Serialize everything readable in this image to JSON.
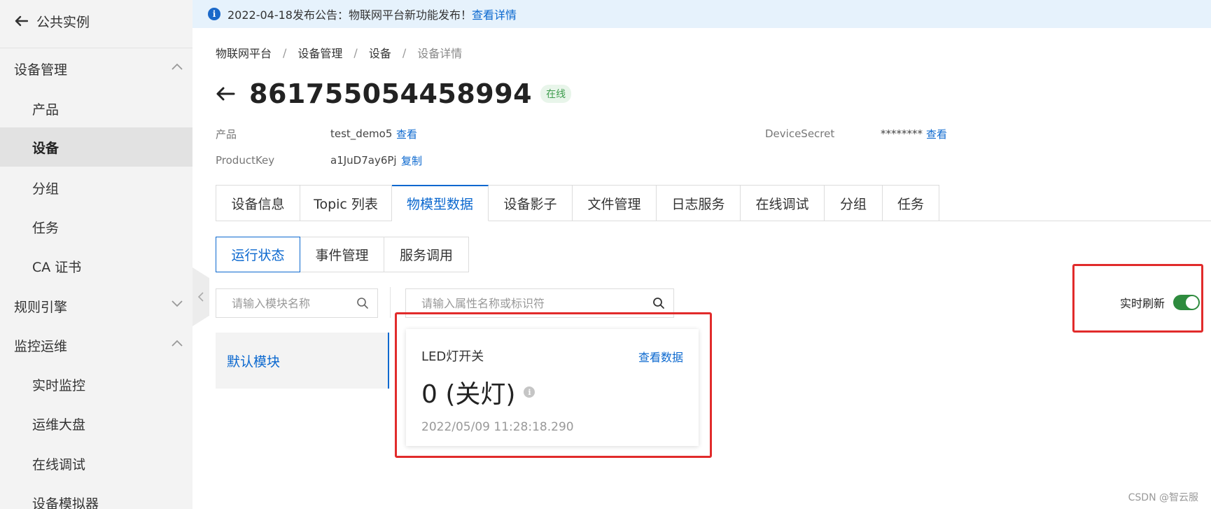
{
  "sidebar": {
    "back_label": "公共实例",
    "groups": [
      {
        "label": "设备管理",
        "expanded": true
      },
      {
        "label": "规则引擎",
        "expanded": false
      },
      {
        "label": "监控运维",
        "expanded": true
      }
    ],
    "device_items": [
      "产品",
      "设备",
      "分组",
      "任务",
      "CA 证书"
    ],
    "monitor_items": [
      "实时监控",
      "运维大盘",
      "在线调试",
      "设备模拟器"
    ],
    "active_item": "设备"
  },
  "notice": {
    "text": "2022-04-18发布公告：物联网平台新功能发布！",
    "link": "查看详情"
  },
  "breadcrumb": [
    "物联网平台",
    "设备管理",
    "设备",
    "设备详情"
  ],
  "device": {
    "name": "861755054458994",
    "status": "在线",
    "product_label": "产品",
    "product_value": "test_demo5",
    "product_action": "查看",
    "productkey_label": "ProductKey",
    "productkey_value": "a1JuD7ay6Pj",
    "productkey_action": "复制",
    "secret_label": "DeviceSecret",
    "secret_value": "********",
    "secret_action": "查看"
  },
  "tabs": [
    "设备信息",
    "Topic 列表",
    "物模型数据",
    "设备影子",
    "文件管理",
    "日志服务",
    "在线调试",
    "分组",
    "任务"
  ],
  "active_tab": "物模型数据",
  "subtabs": [
    "运行状态",
    "事件管理",
    "服务调用"
  ],
  "active_subtab": "运行状态",
  "search": {
    "module_placeholder": "请输入模块名称",
    "property_placeholder": "请输入属性名称或标识符"
  },
  "module": {
    "label": "默认模块"
  },
  "property_card": {
    "name": "LED灯开关",
    "link": "查看数据",
    "value": "0 (关灯)",
    "time": "2022/05/09 11:28:18.290"
  },
  "realtime": {
    "label": "实时刷新",
    "enabled": true
  },
  "colors": {
    "accent": "#0b68cf",
    "highlight": "#e12b2b",
    "toggle_on": "#2e8b3e",
    "online": "#3f9d4e"
  },
  "watermark": "CSDN @智云服"
}
